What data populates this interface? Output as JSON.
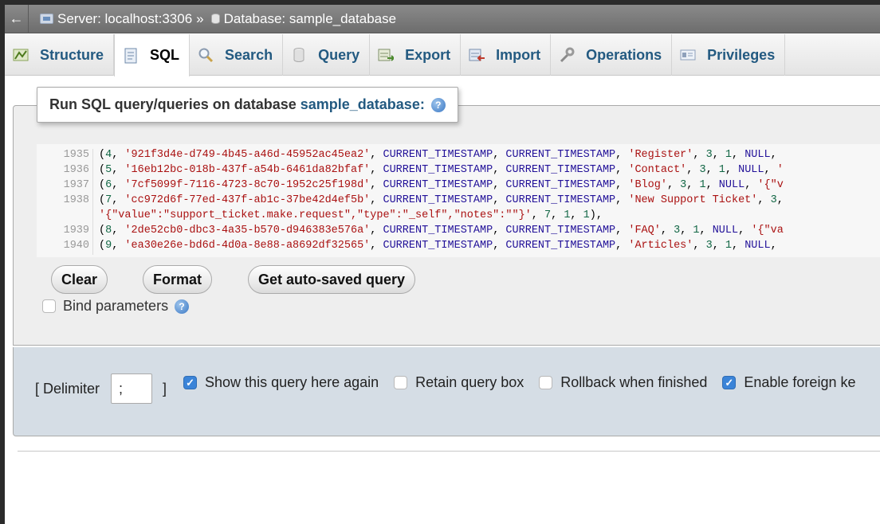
{
  "topbar": {
    "back_glyph": "←",
    "server_label": "Server: localhost:3306",
    "separator": "»",
    "database_label": "Database: sample_database"
  },
  "tabs": [
    {
      "label": "Structure",
      "icon": "structure-icon",
      "active": false
    },
    {
      "label": "SQL",
      "icon": "sql-icon",
      "active": true
    },
    {
      "label": "Search",
      "icon": "search-icon",
      "active": false
    },
    {
      "label": "Query",
      "icon": "query-icon",
      "active": false
    },
    {
      "label": "Export",
      "icon": "export-icon",
      "active": false
    },
    {
      "label": "Import",
      "icon": "import-icon",
      "active": false
    },
    {
      "label": "Operations",
      "icon": "wrench-icon",
      "active": false
    },
    {
      "label": "Privileges",
      "icon": "privileges-icon",
      "active": false
    }
  ],
  "query_box": {
    "legend_prefix": "Run SQL query/queries on database",
    "database": "sample_database:",
    "help_glyph": "?"
  },
  "editor": {
    "lines": [
      {
        "n": "1935",
        "text": "(4, '921f3d4e-d749-4b45-a46d-45952ac45ea2', CURRENT_TIMESTAMP, CURRENT_TIMESTAMP, 'Register', 3, 1, NULL,"
      },
      {
        "n": "1936",
        "text": "(5, '16eb12bc-018b-437f-a54b-6461da82bfaf', CURRENT_TIMESTAMP, CURRENT_TIMESTAMP, 'Contact', 3, 1, NULL, '"
      },
      {
        "n": "1937",
        "text": "(6, '7cf5099f-7116-4723-8c70-1952c25f198d', CURRENT_TIMESTAMP, CURRENT_TIMESTAMP, 'Blog', 3, 1, NULL, '{\"v"
      },
      {
        "n": "1938",
        "text": "(7, 'cc972d6f-77ed-437f-ab1c-37be42d4ef5b', CURRENT_TIMESTAMP, CURRENT_TIMESTAMP, 'New Support Ticket', 3,"
      },
      {
        "n": "",
        "text": "'{\"value\":\"support_ticket.make.request\",\"type\":\"_self\",\"notes\":\"\"}', 7, 1, 1),"
      },
      {
        "n": "1939",
        "text": "(8, '2de52cb0-dbc3-4a35-b570-d946383e576a', CURRENT_TIMESTAMP, CURRENT_TIMESTAMP, 'FAQ', 3, 1, NULL, '{\"va"
      },
      {
        "n": "1940",
        "text": "(9, 'ea30e26e-bd6d-4d0a-8e88-a8692df32565', CURRENT_TIMESTAMP, CURRENT_TIMESTAMP, 'Articles', 3, 1, NULL,"
      }
    ]
  },
  "buttons": {
    "clear": "Clear",
    "format": "Format",
    "autosaved": "Get auto-saved query"
  },
  "bind_parameters": {
    "label": "Bind parameters",
    "checked": false
  },
  "options": {
    "delimiter_open": "[ Delimiter",
    "delimiter_value": ";",
    "delimiter_close": "]",
    "show_query_again": {
      "label": "Show this query here again",
      "checked": true
    },
    "retain_query_box": {
      "label": "Retain query box",
      "checked": false
    },
    "rollback": {
      "label": "Rollback when finished",
      "checked": false
    },
    "foreign_keys": {
      "label": "Enable foreign ke",
      "checked": true
    }
  },
  "colors": {
    "link": "#235a81",
    "checkbox_checked": "#3b84d8",
    "options_bg": "#d5dde5"
  }
}
